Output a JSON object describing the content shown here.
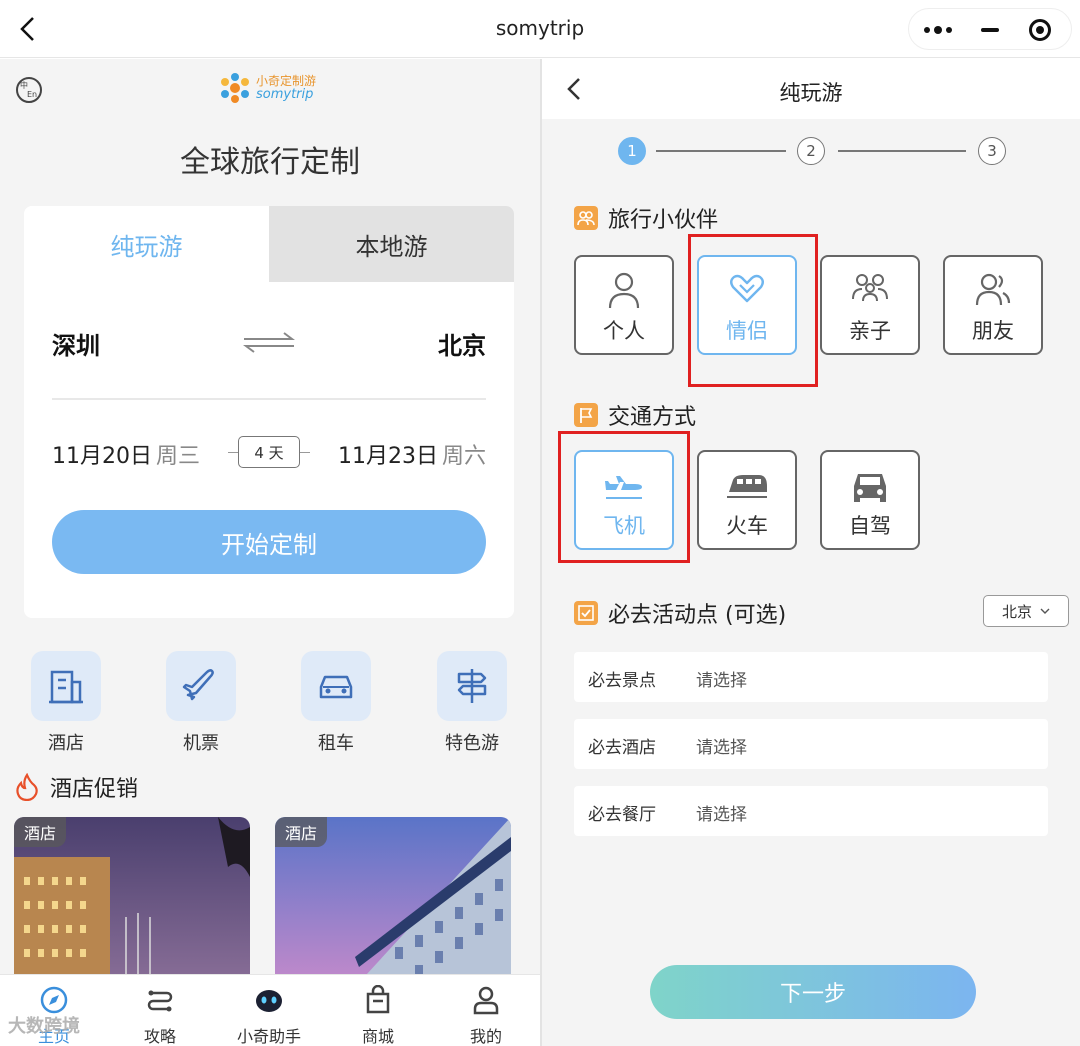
{
  "window": {
    "title": "somytrip"
  },
  "left": {
    "logo": {
      "cn": "小奇定制游",
      "en": "somytrip"
    },
    "main_title": "全球旅行定制",
    "tabs": [
      {
        "label": "纯玩游",
        "active": true
      },
      {
        "label": "本地游",
        "active": false
      }
    ],
    "from_city": "深圳",
    "to_city": "北京",
    "start_date": "11月20日",
    "start_weekday": "周三",
    "duration": "4 天",
    "end_date": "11月23日",
    "end_weekday": "周六",
    "start_button": "开始定制",
    "quick_links": [
      {
        "label": "酒店",
        "icon": "hotel-icon"
      },
      {
        "label": "机票",
        "icon": "plane-icon"
      },
      {
        "label": "租车",
        "icon": "car-icon"
      },
      {
        "label": "特色游",
        "icon": "signpost-icon"
      }
    ],
    "promo_title": "酒店促销",
    "promo_cards": [
      {
        "tag": "酒店"
      },
      {
        "tag": "酒店"
      }
    ],
    "tabbar": [
      {
        "label": "主页",
        "icon": "compass-icon",
        "active": true
      },
      {
        "label": "攻略",
        "icon": "route-icon",
        "active": false
      },
      {
        "label": "小奇助手",
        "icon": "robot-icon",
        "active": false
      },
      {
        "label": "商城",
        "icon": "shop-bag-icon",
        "active": false
      },
      {
        "label": "我的",
        "icon": "user-icon",
        "active": false
      }
    ],
    "watermark": "大数跨境"
  },
  "right": {
    "title": "纯玩游",
    "steps": [
      "1",
      "2",
      "3"
    ],
    "current_step": 1,
    "partner_title": "旅行小伙伴",
    "partners": [
      {
        "label": "个人",
        "icon": "person-icon",
        "selected": false
      },
      {
        "label": "情侣",
        "icon": "hearts-icon",
        "selected": true
      },
      {
        "label": "亲子",
        "icon": "family-icon",
        "selected": false
      },
      {
        "label": "朋友",
        "icon": "friends-icon",
        "selected": false
      }
    ],
    "transport_title": "交通方式",
    "transports": [
      {
        "label": "飞机",
        "icon": "airplane-icon",
        "selected": true
      },
      {
        "label": "火车",
        "icon": "train-icon",
        "selected": false
      },
      {
        "label": "自驾",
        "icon": "car-icon",
        "selected": false
      }
    ],
    "activity_title": "必去活动点 (可选)",
    "city_select": "北京",
    "musts": [
      {
        "key": "必去景点",
        "value": "请选择"
      },
      {
        "key": "必去酒店",
        "value": "请选择"
      },
      {
        "key": "必去餐厅",
        "value": "请选择"
      }
    ],
    "next_button": "下一步"
  },
  "colors": {
    "accent": "#6fb6ef",
    "highlight": "#e02020",
    "section_icon": "#f3a447"
  }
}
